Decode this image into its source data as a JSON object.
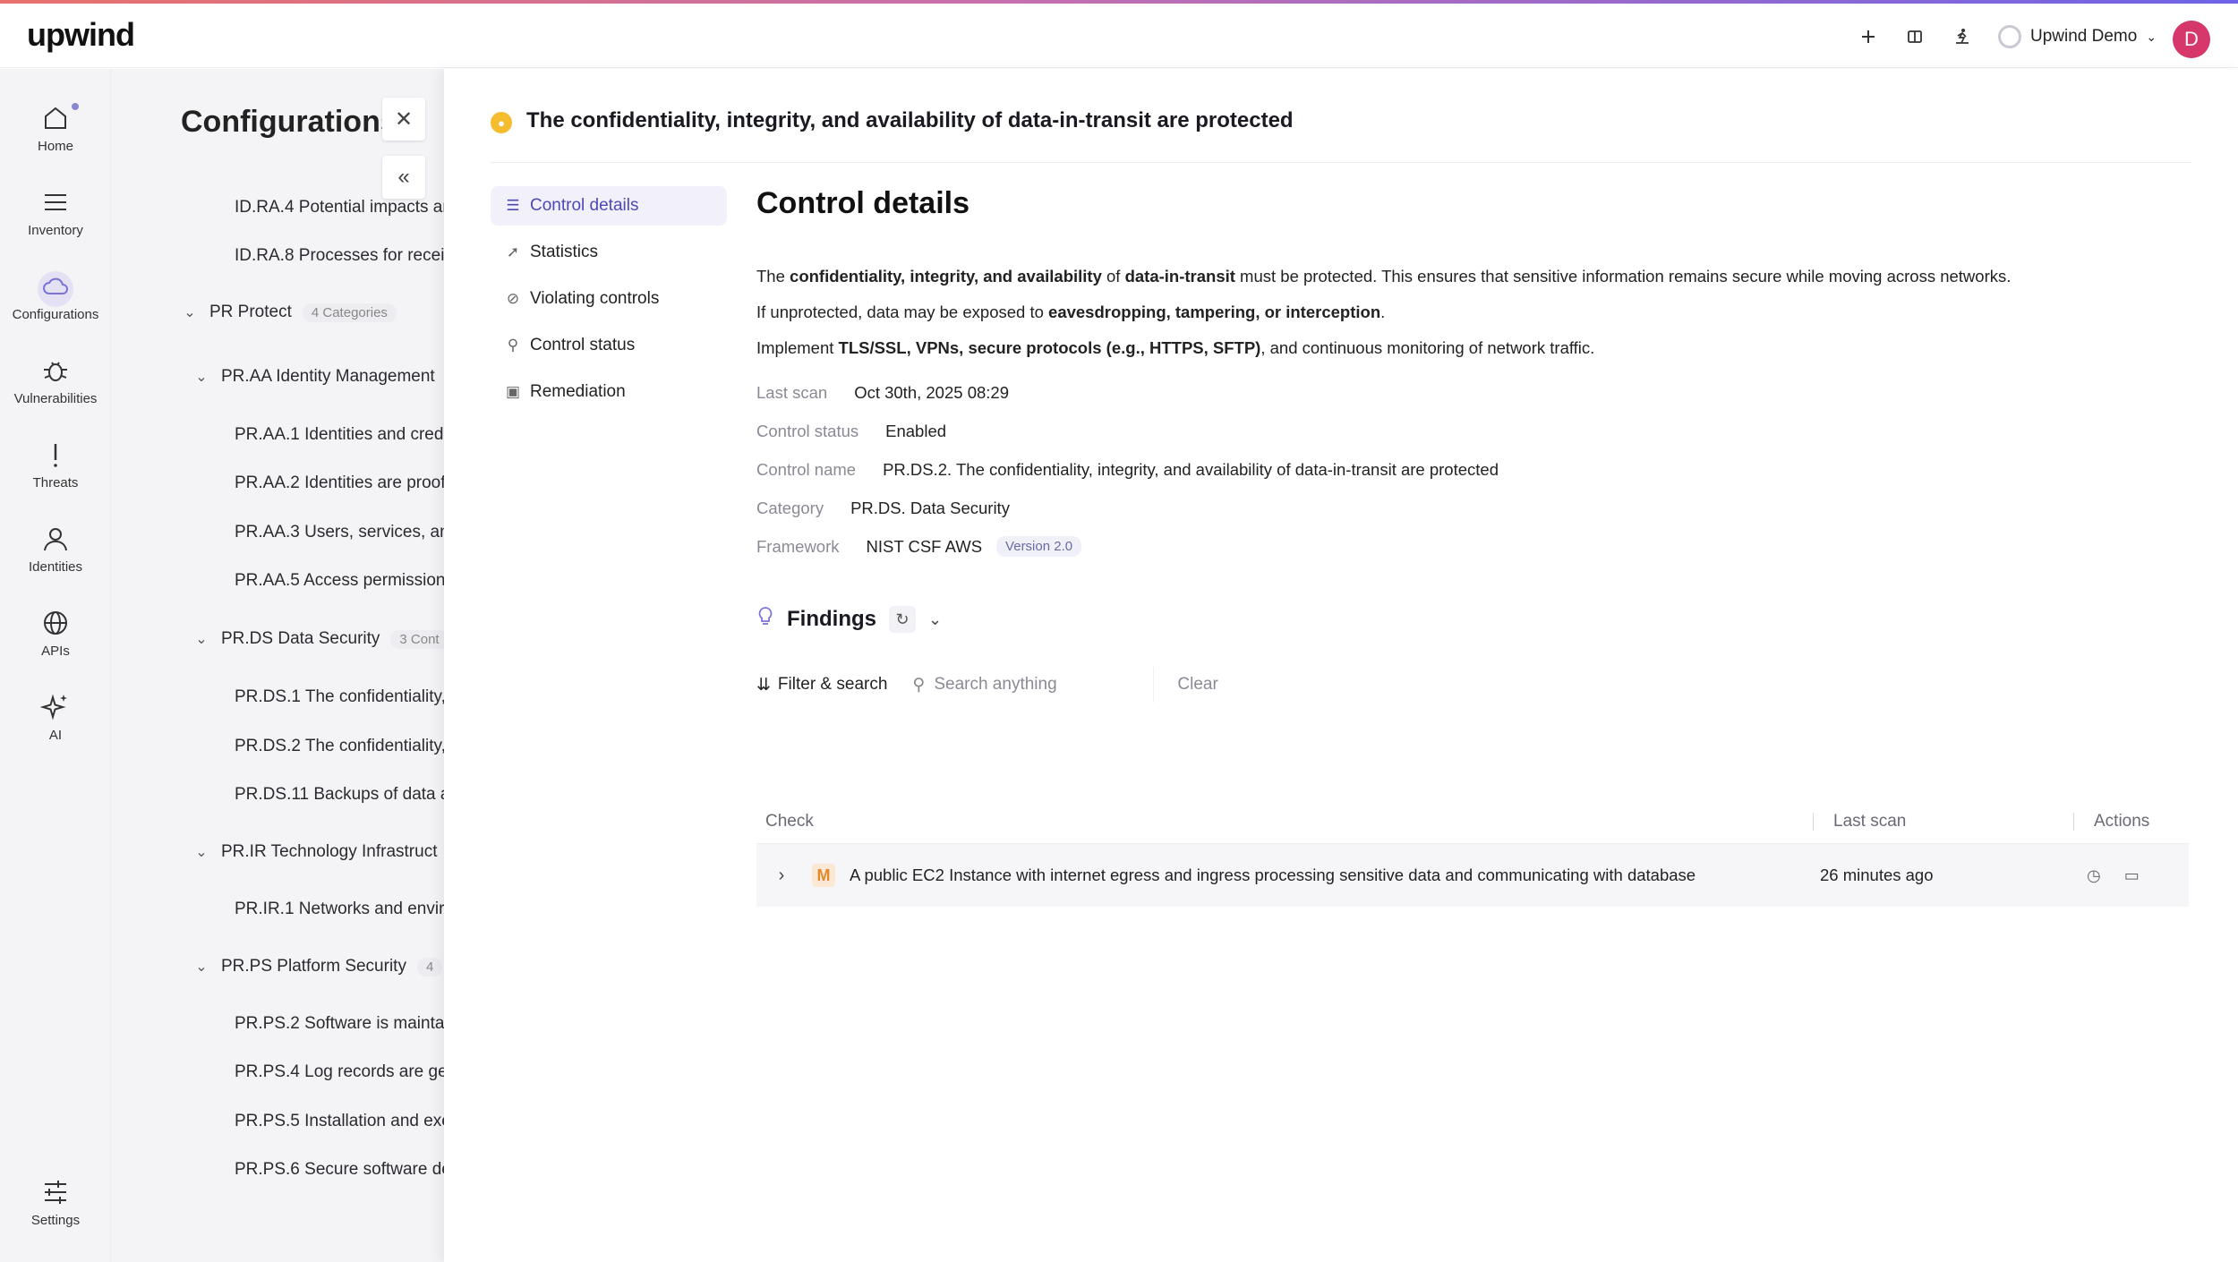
{
  "app": {
    "logo_text": "upwind",
    "org_name": "Upwind Demo",
    "avatar_initial": "D",
    "accent": "#4d48b8",
    "avatar_color": "#d6386c"
  },
  "topbar_icons": [
    "plus-icon",
    "book-icon",
    "walker-icon"
  ],
  "rail": {
    "items": [
      {
        "label": "Home",
        "icon": "home-icon"
      },
      {
        "label": "Inventory",
        "icon": "list-icon"
      },
      {
        "label": "Configurations",
        "icon": "cloud-icon"
      },
      {
        "label": "Vulnerabilities",
        "icon": "bug-icon"
      },
      {
        "label": "Threats",
        "icon": "exclamation-icon"
      },
      {
        "label": "Identities",
        "icon": "person-icon"
      },
      {
        "label": "APIs",
        "icon": "globe-icon"
      },
      {
        "label": "AI",
        "icon": "sparkle-icon"
      }
    ],
    "settings_label": "Settings"
  },
  "tree": {
    "title": "Configurations",
    "rows": [
      "ID.RA.4 Potential impacts an",
      "ID.RA.8 Processes for receiv",
      "PR.AA.1 Identities and crede",
      "PR.AA.2 Identities are proofe",
      "PR.AA.3 Users, services, and",
      "PR.AA.5 Access permissions",
      "PR.DS.1 The confidentiality,",
      "PR.DS.2 The confidentiality,",
      "PR.DS.11 Backups of data ar",
      "PR.IR.1 Networks and enviro",
      "PR.PS.2 Software is maintair",
      "PR.PS.4 Log records are ger",
      "PR.PS.5 Installation and exec",
      "PR.PS.6 Secure software de"
    ],
    "groups": [
      {
        "label": "PR Protect",
        "count": "4 Categories"
      },
      {
        "label": "PR.AA Identity Management",
        "count": ""
      },
      {
        "label": "PR.DS Data Security",
        "count": "3 Cont"
      },
      {
        "label": "PR.IR Technology Infrastruct",
        "count": ""
      },
      {
        "label": "PR.PS Platform Security",
        "count": "4"
      }
    ]
  },
  "control": {
    "title": "The confidentiality, integrity, and availability of data-in-transit are protected",
    "subnav": [
      {
        "label": "Control details",
        "icon": "list-icon"
      },
      {
        "label": "Statistics",
        "icon": "chart-icon"
      },
      {
        "label": "Violating controls",
        "icon": "block-icon"
      },
      {
        "label": "Control status",
        "icon": "search-icon"
      },
      {
        "label": "Remediation",
        "icon": "archive-icon"
      }
    ],
    "heading": "Control details",
    "desc": {
      "p1_a": "The ",
      "p1_b": "confidentiality, integrity, and availability",
      "p1_c": " of ",
      "p1_d": "data-in-transit",
      "p1_e": " must be protected. This ensures that sensitive information remains secure while moving across networks.",
      "p2_a": "If unprotected, data may be exposed to ",
      "p2_b": "eavesdropping, tampering, or interception",
      "p2_c": ".",
      "p3_a": "Implement ",
      "p3_b": "TLS/SSL, VPNs, secure protocols (e.g., HTTPS, SFTP)",
      "p3_c": ", and continuous monitoring of network traffic."
    },
    "fields": {
      "last_scan_label": "Last scan",
      "last_scan_value": "Oct 30th, 2025 08:29",
      "status_label": "Control status",
      "status_value": "Enabled",
      "name_label": "Control name",
      "name_value": "PR.DS.2. The confidentiality, integrity, and availability of data-in-transit are protected",
      "category_label": "Category",
      "category_value": "PR.DS. Data Security",
      "framework_label": "Framework",
      "framework_value": "NIST CSF AWS",
      "framework_version": "Version 2.0"
    }
  },
  "findings": {
    "title": "Findings",
    "filter_label": "Filter & search",
    "search_placeholder": "Search anything",
    "clear_label": "Clear",
    "columns": {
      "check": "Check",
      "last_scan": "Last scan",
      "actions": "Actions"
    },
    "rows": [
      {
        "severity": "M",
        "check": "A public EC2 Instance with internet egress and ingress processing sensitive data and communicating with database",
        "last_scan": "26 minutes ago"
      }
    ]
  }
}
